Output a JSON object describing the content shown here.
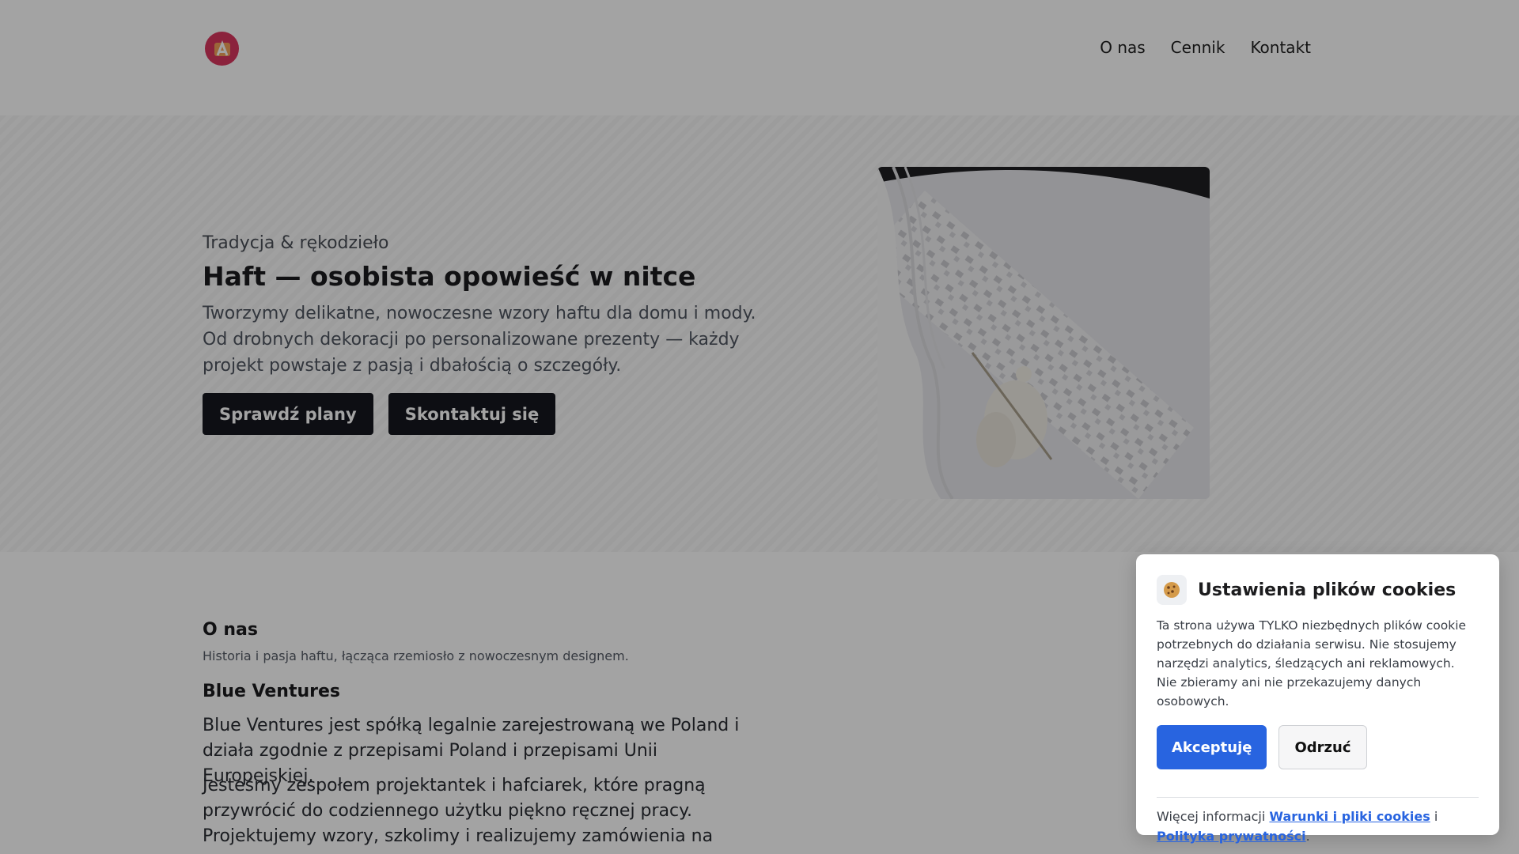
{
  "header": {
    "logo_name": "brand-logo",
    "nav": [
      {
        "label": "O nas"
      },
      {
        "label": "Cennik"
      },
      {
        "label": "Kontakt"
      }
    ]
  },
  "hero": {
    "eyebrow": "Tradycja & rękodzieło",
    "title": "Haft — osobista opowieść w nitce",
    "description": "Tworzymy delikatne, nowoczesne wzory haftu dla domu i mody. Od drobnych dekoracji po personalizowane prezenty — każdy projekt powstaje z pasją i dbałością o szczegóły.",
    "buttons": [
      {
        "label": "Sprawdź plany"
      },
      {
        "label": "Skontaktuj się"
      }
    ]
  },
  "about": {
    "title": "O nas",
    "subtitle": "Historia i pasja haftu, łącząca rzemiosło z nowoczesnym designem.",
    "company": "Blue Ventures",
    "paragraph1": "Blue Ventures jest spółką legalnie zarejestrowaną we Poland i działa zgodnie z przepisami Poland i przepisami Unii Europejskiej.",
    "paragraph2": "Jesteśmy zespołem projektantek i hafciarek, które pragną przywrócić do codziennego użytku piękno ręcznej pracy. Projektujemy wzory, szkolimy i realizujemy zamówienia na"
  },
  "cookie": {
    "icon": "cookie-icon",
    "title": "Ustawienia plików cookies",
    "text": "Ta strona używa TYLKO niezbędnych plików cookie potrzebnych do działania serwisu. Nie stosujemy narzędzi analytics, śledzących ani reklamowych. Nie zbieramy ani nie przekazujemy danych osobowych.",
    "accept_label": "Akceptuję",
    "reject_label": "Odrzuć",
    "more_prefix": "Więcej informacji",
    "terms_link": "Warunki i pliki cookies",
    "connector": "i",
    "privacy_link": "Polityka prywatności",
    "suffix": "."
  },
  "colors": {
    "primary_dark": "#15171f",
    "accent_blue": "#2864e0",
    "logo_red": "#d9365e"
  }
}
